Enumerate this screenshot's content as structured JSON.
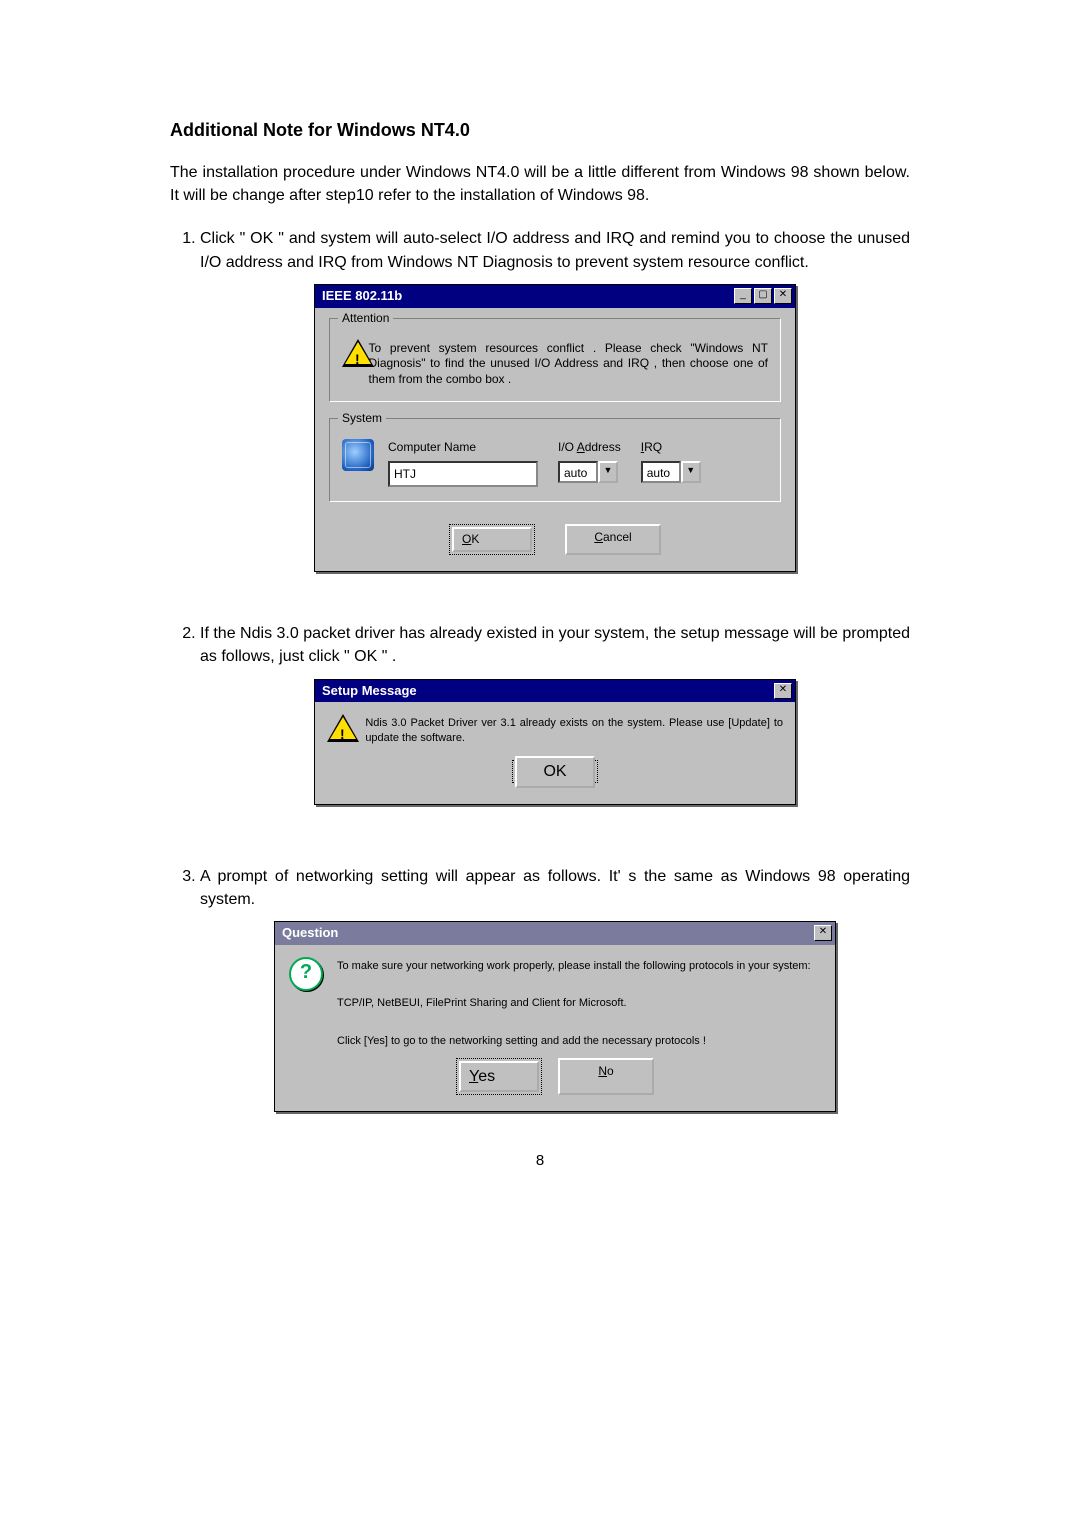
{
  "heading": "Additional Note for Windows NT4.0",
  "intro": "The installation procedure under Windows NT4.0 will be a little different from Windows 98 shown below. It will be change after step10 refer to the installation of Windows 98.",
  "steps": [
    "Click  \" OK \"  and system will auto-select I/O address and IRQ and remind you to choose the unused I/O address and IRQ from Windows NT Diagnosis to prevent system resource conflict.",
    "If the Ndis 3.0 packet driver has already existed in your system, the setup message will be prompted as follows, just click  \" OK \" .",
    "A prompt of networking setting will appear as follows. It' s the same as Windows 98 operating system."
  ],
  "dlg1": {
    "title": "IEEE 802.11b",
    "group_attention": "Attention",
    "attention_text": "To prevent system resources conflict . Please check \"Windows NT Diagnosis\" to find the unused I/O Address and IRQ , then choose one of them from the combo box .",
    "group_system": "System",
    "computer_name_label": "Computer Name",
    "computer_name_value": "HTJ",
    "io_address_label_pre": "I/O ",
    "io_address_label_u": "A",
    "io_address_label_post": "ddress",
    "io_address_value": "auto",
    "irq_label_u": "I",
    "irq_label_post": "RQ",
    "irq_value": "auto",
    "ok_pre": "",
    "ok_u": "O",
    "ok_post": "K",
    "cancel_u": "C",
    "cancel_post": "ancel"
  },
  "dlg2": {
    "title": "Setup Message",
    "text": "Ndis 3.0 Packet Driver ver 3.1 already exists on the system. Please use [Update] to update the software.",
    "ok": "OK"
  },
  "dlg3": {
    "title": "Question",
    "l1": "To make sure your networking work properly, please install the following protocols in your system:",
    "l2": "TCP/IP, NetBEUI, FilePrint Sharing and Client for Microsoft.",
    "l3": "Click [Yes] to go to the networking setting and add the necessary protocols !",
    "yes_u": "Y",
    "yes_post": "es",
    "no_u": "N",
    "no_post": "o"
  },
  "page_number": "8"
}
